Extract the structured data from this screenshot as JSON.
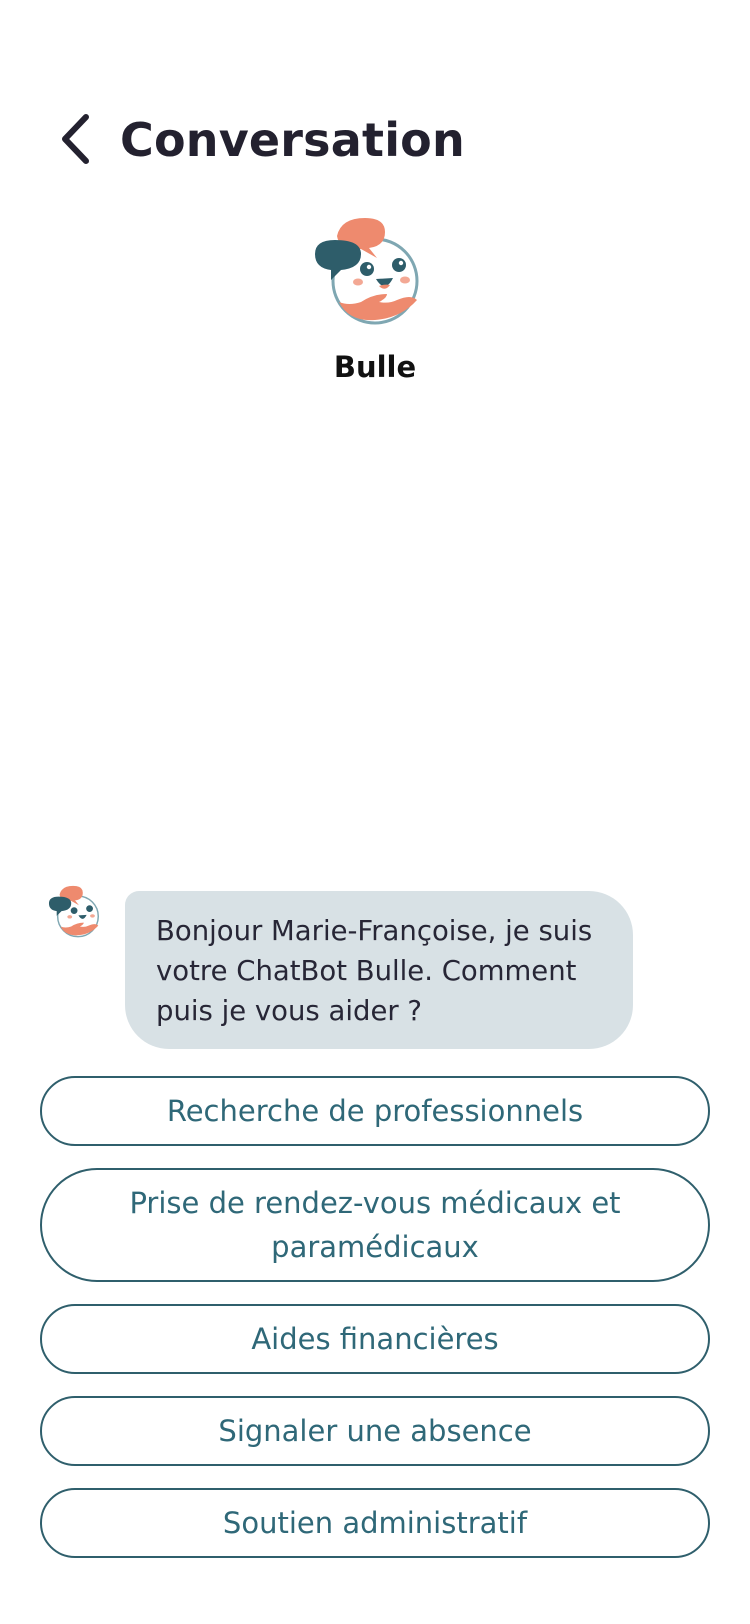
{
  "header": {
    "title": "Conversation",
    "back_icon": "chevron-left-icon"
  },
  "bot": {
    "name": "Bulle",
    "avatar_icon": "bulle-mascot-icon"
  },
  "message": {
    "text": "Bonjour Marie-Françoise, je suis votre ChatBot Bulle. Comment puis je vous aider ?"
  },
  "choices": [
    {
      "label": "Recherche de professionnels"
    },
    {
      "label": "Prise de rendez-vous médicaux et paramédicaux"
    },
    {
      "label": "Aides financières"
    },
    {
      "label": "Signaler une absence"
    },
    {
      "label": "Soutien administratif"
    }
  ],
  "colors": {
    "accent": "#2f6878",
    "bubble": "#d8e1e5",
    "coral": "#ee8a6e",
    "teal_dark": "#2e5d6a"
  }
}
